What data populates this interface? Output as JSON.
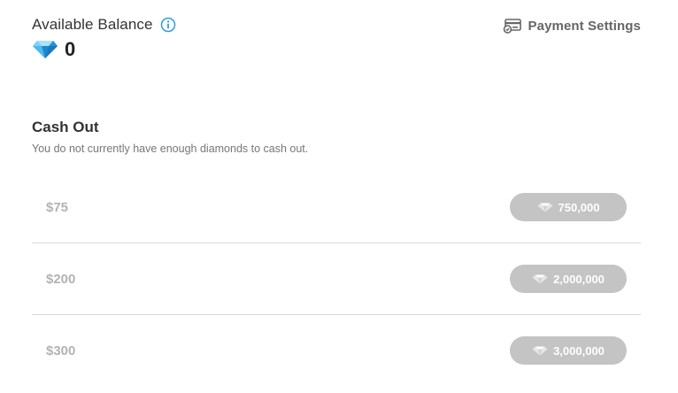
{
  "balance": {
    "title": "Available Balance",
    "value": "0",
    "icons": {
      "info": "info-icon",
      "currency": "diamond-icon"
    }
  },
  "payment_settings": {
    "label": "Payment Settings",
    "icon": "card-settings-icon"
  },
  "cash_out": {
    "title": "Cash Out",
    "subtitle": "You do not currently have enough diamonds to cash out.",
    "tiers": [
      {
        "amount": "$75",
        "cost": "750,000"
      },
      {
        "amount": "$200",
        "cost": "2,000,000"
      },
      {
        "amount": "$300",
        "cost": "3,000,000"
      }
    ]
  },
  "colors": {
    "accent_blue": "#2d9cdb",
    "disabled_button": "#c4c4c4",
    "divider": "#d9d9d9"
  }
}
